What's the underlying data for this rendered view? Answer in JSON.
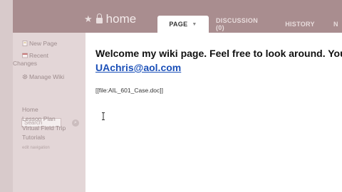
{
  "header": {
    "page_title": "home",
    "tabs": [
      {
        "label": "PAGE",
        "active": true
      },
      {
        "label": "DISCUSSION (0)",
        "active": false
      },
      {
        "label": "HISTORY",
        "active": false
      },
      {
        "label": "N",
        "active": false
      }
    ]
  },
  "sidebar": {
    "new_page": "New Page",
    "recent_changes_line1": "Recent",
    "recent_changes_line2": "Changes",
    "manage_wiki": "Manage Wiki",
    "search_placeholder": "Search",
    "nav": [
      "Home",
      "Lesson Plan",
      "Virtual Field Trip",
      "Tutorials"
    ],
    "edit_navigation": "edit navigation"
  },
  "content": {
    "welcome": "Welcome my wiki page. Feel free to look around. You",
    "email": "UAchris@aol.com",
    "file_link": "[[file:AIL_601_Case.doc]]"
  },
  "colors": {
    "header_bg": "#a98d8f",
    "sidebar_bg": "#e3d6d7",
    "link": "#1a4fb8"
  }
}
